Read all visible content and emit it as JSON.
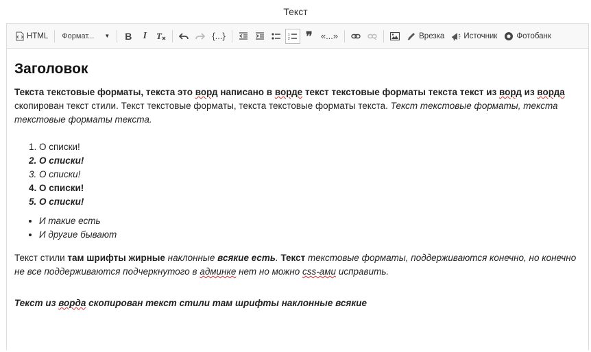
{
  "dialog": {
    "title": "Текст"
  },
  "toolbar": {
    "source_html_label": "HTML",
    "format_combo_value": "Формат...",
    "code_label": "{...}",
    "quote_label": "«...»",
    "inset_label": "Врезка",
    "source_label": "Источник",
    "photobank_label": "Фотобанк",
    "icons": [
      "html-source-icon",
      "bold-icon",
      "italic-icon",
      "remove-format-icon",
      "undo-icon",
      "redo-icon",
      "code-icon",
      "outdent-icon",
      "indent-icon",
      "bulleted-list-icon",
      "numbered-list-icon",
      "blockquote-icon",
      "quotes-icon",
      "link-icon",
      "unlink-icon",
      "image-icon",
      "pen-icon",
      "megaphone-icon",
      "photobank-icon"
    ]
  },
  "content": {
    "heading": "Заголовок",
    "p1": {
      "a": "Текста текстовые форматы, текста это ",
      "b": "ворд",
      "c": " написано в ",
      "d": "ворде",
      "e": " текст текстовые форматы текста текст из ",
      "f": "ворд",
      "g": " из ",
      "h": "ворда",
      "i": " скопирован текст стили. Текст текстовые форматы, текста текстовые форматы текста. ",
      "j": "Текст текстовые форматы, текста текстовые форматы текста."
    },
    "ordered_list": [
      "О списки!",
      "О списки!",
      "О списки!",
      "О списки!",
      "О списки!"
    ],
    "bullet_list": [
      "И такие есть",
      "И другие бывают"
    ],
    "p2": {
      "a": "Текст стили ",
      "b": "там шрифты жирные",
      "c": " наклонные ",
      "d": "всякие есть",
      "e": ". ",
      "f": "Текст",
      "g": " текстовые форматы, поддерживаются конечно, но конечно не все поддерживаются подчеркнутого в ",
      "h": "админке",
      "i": " нет но можно ",
      "j": "css-ами",
      "k": " исправить."
    },
    "p3": {
      "a": "Текст из ",
      "b": "ворда",
      "c": " скопирован текст стили там шрифты наклонные всякие"
    }
  }
}
